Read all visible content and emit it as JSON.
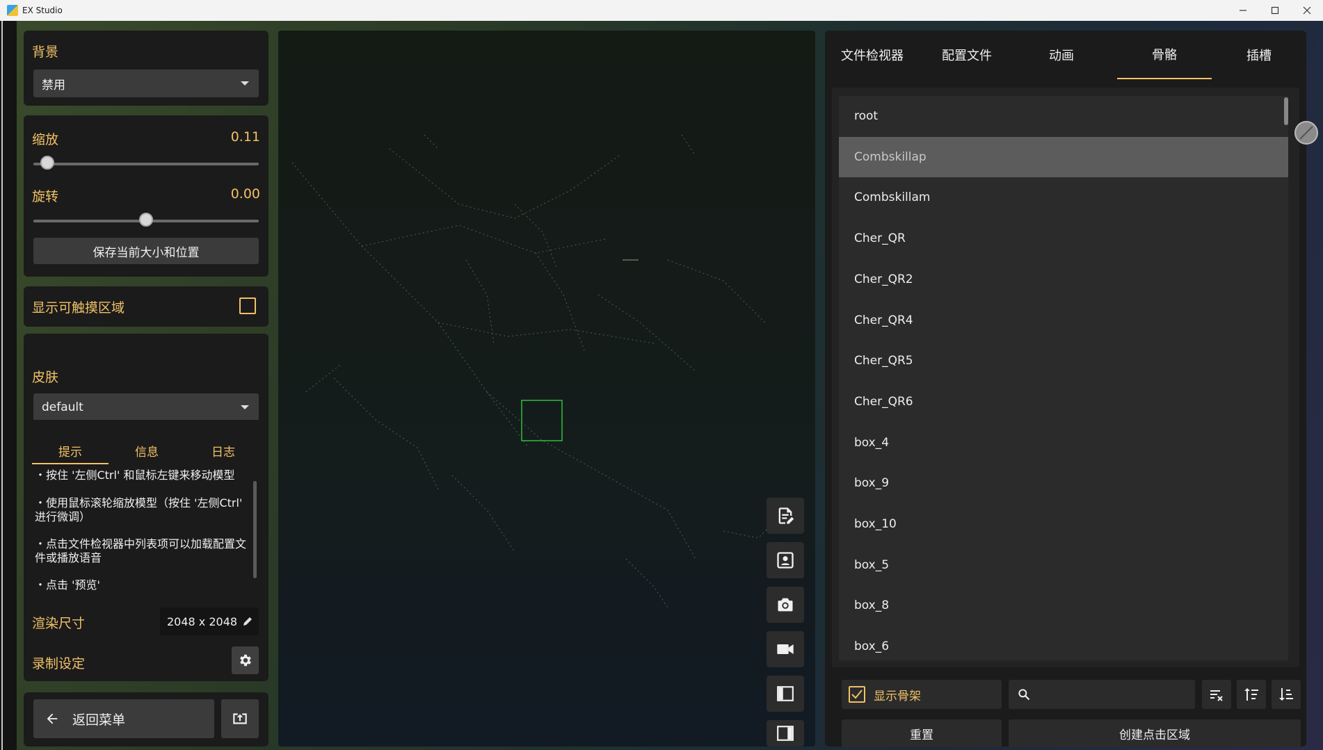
{
  "window": {
    "title": "EX Studio"
  },
  "left": {
    "background": {
      "label": "背景",
      "value": "禁用"
    },
    "scale": {
      "label": "缩放",
      "value": "0.11",
      "fraction": 0.03
    },
    "rotate": {
      "label": "旋转",
      "value": "0.00",
      "fraction": 0.5
    },
    "save_button": "保存当前大小和位置",
    "touch_area": {
      "label": "显示可触摸区域",
      "checked": false
    },
    "skin": {
      "label": "皮肤",
      "value": "default"
    },
    "info_tabs": [
      "提示",
      "信息",
      "日志"
    ],
    "tips": [
      "・按住 '左侧Ctrl' 和鼠标左键来移动模型",
      "・使用鼠标滚轮缩放模型（按住 '左侧Ctrl' 进行微调）",
      "・点击文件检视器中列表项可以加载配置文件或播放语音",
      "・点击 '预览'"
    ],
    "render_size": {
      "label": "渲染尺寸",
      "value": "2048 x 2048"
    },
    "record_settings": {
      "label": "录制设定"
    },
    "back_button": "返回菜单"
  },
  "right": {
    "tabs": [
      "文件检视器",
      "配置文件",
      "动画",
      "骨骼",
      "插槽"
    ],
    "active_tab": "骨骼",
    "bones": [
      "root",
      "Combskillap",
      "Combskillam",
      "Cher_QR",
      "Cher_QR2",
      "Cher_QR4",
      "Cher_QR5",
      "Cher_QR6",
      "box_4",
      "box_9",
      "box_10",
      "box_5",
      "box_8",
      "box_6"
    ],
    "selected_bone": "Combskillap",
    "show_skeleton": {
      "label": "显示骨架",
      "checked": true
    },
    "search": {
      "placeholder": ""
    },
    "reset_button": "重置",
    "create_hit_area_button": "创建点击区域"
  },
  "colors": {
    "accent": "#f2c167",
    "selected_row": "#5c5c5c"
  },
  "icons": {
    "viewport_tools": [
      "file-edit-icon",
      "contact-card-icon",
      "camera-icon",
      "video-camera-icon",
      "panel-left-icon",
      "panel-right-icon"
    ]
  }
}
